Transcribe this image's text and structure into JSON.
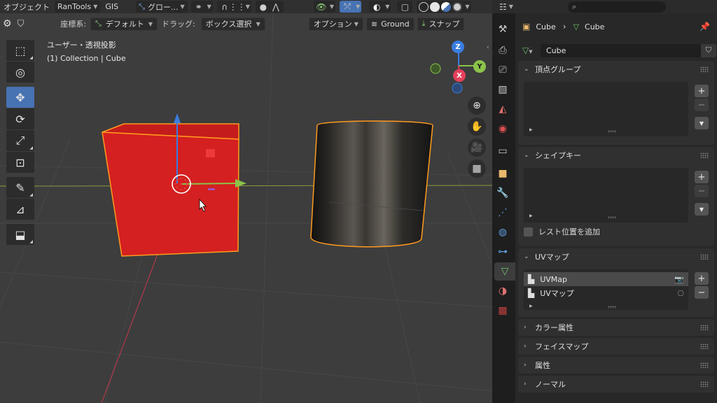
{
  "header": {
    "mode": "オブジェクト",
    "menu_rantools": "RanTools",
    "menu_gis": "GIS",
    "transform_orientation": "グロー..."
  },
  "tool_settings": {
    "coord_label": "座標系:",
    "coord_value": "デフォルト",
    "drag_label": "ドラッグ:",
    "drag_value": "ボックス選択",
    "options": "オプション",
    "ground": "Ground",
    "snap": "スナップ"
  },
  "viewport": {
    "view_name": "ユーザー・透視投影",
    "collection_info": "(1) Collection | Cube",
    "gizmo": {
      "z": "Z",
      "y": "Y",
      "x": "X"
    },
    "colors": {
      "background": "#3d3d3d",
      "cube_fill": "#d11e1e",
      "selection_outline": "#ff9a1f",
      "axis_x": "#e4405a",
      "axis_y": "#8bc34a",
      "axis_z": "#3a7de0"
    }
  },
  "toolbar": {
    "tools": [
      {
        "icon": "select-box-icon",
        "glyph": "⬚",
        "active": false
      },
      {
        "icon": "cursor-icon",
        "glyph": "◎",
        "active": false
      },
      {
        "icon": "move-icon",
        "glyph": "✥",
        "active": true
      },
      {
        "icon": "rotate-icon",
        "glyph": "⟳",
        "active": false
      },
      {
        "icon": "scale-icon",
        "glyph": "⤢",
        "active": false
      },
      {
        "icon": "transform-icon",
        "glyph": "⊡",
        "active": false
      },
      {
        "icon": "annotate-icon",
        "glyph": "✎",
        "active": false
      },
      {
        "icon": "measure-icon",
        "glyph": "📐",
        "active": false
      },
      {
        "icon": "add-cube-icon",
        "glyph": "⬓",
        "active": false
      }
    ]
  },
  "properties": {
    "breadcrumb": {
      "object": "Cube",
      "mesh": "Cube"
    },
    "datablock_name": "Cube",
    "panels": {
      "vertex_groups": "頂点グループ",
      "shape_keys": "シェイプキー",
      "add_rest_position": "レスト位置を追加",
      "uv_maps": "UVマップ",
      "uv_items": [
        "UVMap",
        "UVマップ"
      ],
      "color_attributes": "カラー属性",
      "face_maps": "フェイスマップ",
      "attributes": "属性",
      "normals": "ノーマル"
    },
    "tab_icons": [
      "tool-icon",
      "render-icon",
      "output-icon",
      "view-layer-icon",
      "scene-icon",
      "world-icon",
      "collection-icon",
      "object-icon",
      "modifier-icon",
      "particles-icon",
      "physics-icon",
      "constraints-icon",
      "mesh-data-icon",
      "material-icon",
      "texture-icon"
    ],
    "colors": {
      "mesh_green": "#6fc06b",
      "object_orange": "#e9b86c"
    }
  }
}
